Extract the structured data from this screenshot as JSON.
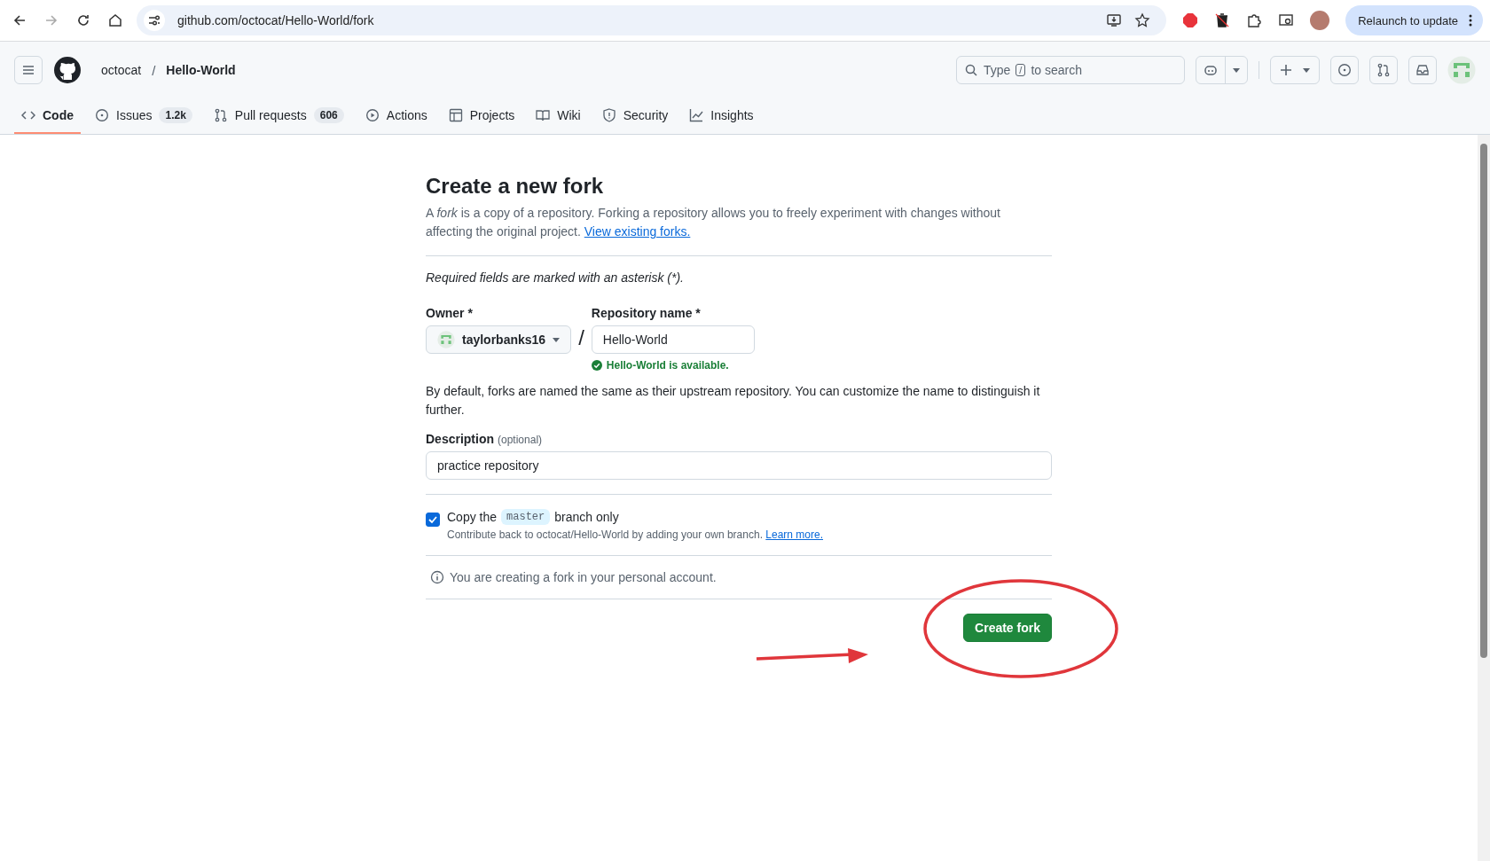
{
  "browser": {
    "url": "github.com/octocat/Hello-World/fork",
    "relaunch": "Relaunch to update"
  },
  "header": {
    "owner": "octocat",
    "separator": "/",
    "repo": "Hello-World",
    "search_before": "Type",
    "search_key": "/",
    "search_after": "to search"
  },
  "tabs": [
    {
      "kind": "code",
      "label": "Code",
      "selected": true
    },
    {
      "kind": "issues",
      "label": "Issues",
      "count": "1.2k",
      "selected": false
    },
    {
      "kind": "pulls",
      "label": "Pull requests",
      "count": "606",
      "selected": false
    },
    {
      "kind": "actions",
      "label": "Actions",
      "selected": false
    },
    {
      "kind": "projects",
      "label": "Projects",
      "selected": false
    },
    {
      "kind": "wiki",
      "label": "Wiki",
      "selected": false
    },
    {
      "kind": "security",
      "label": "Security",
      "selected": false
    },
    {
      "kind": "insights",
      "label": "Insights",
      "selected": false
    }
  ],
  "form": {
    "title": "Create a new fork",
    "intro": "A *fork* is a copy of a repository. Forking a repository allows you to freely experiment with changes without affecting the original project.",
    "intro_link": "View existing forks.",
    "required_note": "Required fields are marked with an asterisk (*).",
    "owner_label": "Owner *",
    "owner_value": "taylorbanks16",
    "slash": "/",
    "repo_label": "Repository name *",
    "repo_value": "Hello-World",
    "availability": "Hello-World is available.",
    "default_note": "By default, forks are named the same as their upstream repository. You can customize the name to distinguish it further.",
    "description_label": "Description",
    "description_optional": "(optional)",
    "description_value": "practice repository",
    "copy_checked": true,
    "copy_before": "Copy the",
    "branch": "master",
    "copy_after": "branch only",
    "contribute_note": "Contribute back to octocat/Hello-World by adding your own branch.",
    "learn_more": "Learn more.",
    "info_note": "You are creating a fork in your personal account.",
    "submit": "Create fork"
  }
}
